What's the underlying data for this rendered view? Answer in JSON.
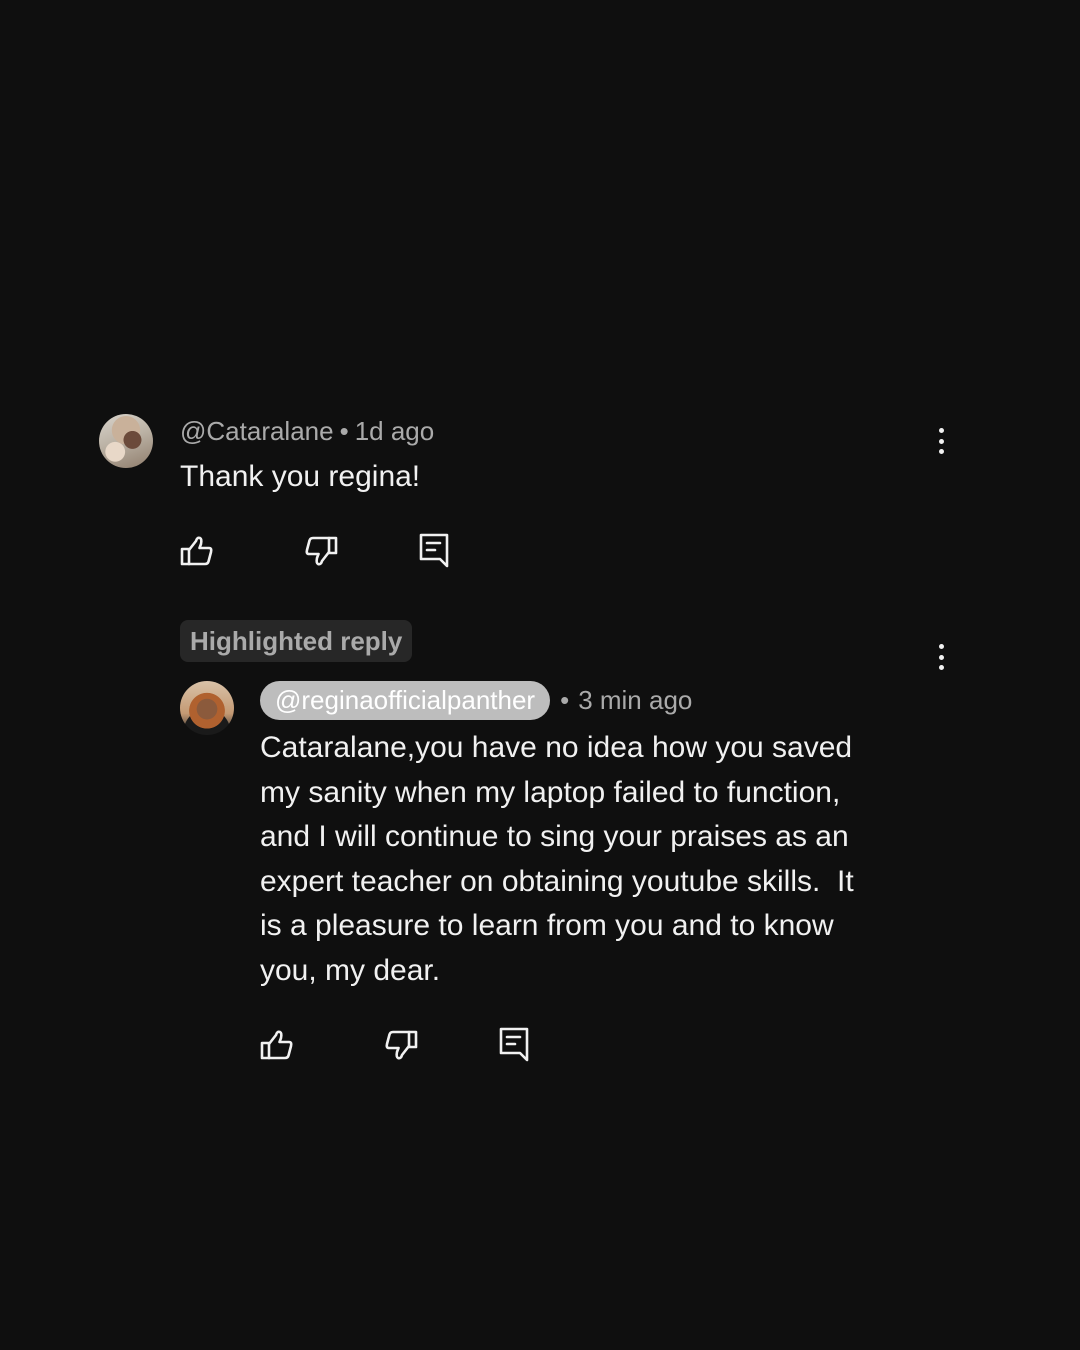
{
  "comment": {
    "author": "@Cataralane",
    "separator": "•",
    "time": "1d ago",
    "text": "Thank you regina!",
    "avatar_icon": "user-avatar-photo",
    "actions": [
      "like-icon",
      "dislike-icon",
      "reply-icon"
    ],
    "menu_icon": "more-vert-icon"
  },
  "reply": {
    "badge": "Highlighted reply",
    "author": "@reginaofficialpanther",
    "separator": "•",
    "time": "3 min ago",
    "text_lines": [
      "Cataralane,you have no idea how you saved",
      "my sanity when my laptop failed to function,",
      "and I will continue to sing your praises as an",
      "expert teacher on obtaining youtube skills.  It",
      "is a pleasure to learn from you and to know",
      "you, my dear."
    ],
    "avatar_icon": "user-avatar-photo",
    "actions": [
      "like-icon",
      "dislike-icon",
      "reply-icon"
    ],
    "menu_icon": "more-vert-icon"
  },
  "colors": {
    "background": "#0f0f0f",
    "primary_text": "#f1f1f1",
    "secondary_text": "#aaaaaa",
    "badge_bg": "#272727",
    "handle_chip_bg": "#bdbdbd"
  }
}
